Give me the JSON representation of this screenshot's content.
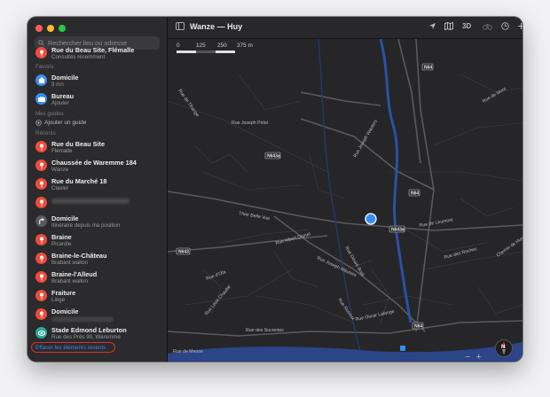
{
  "window": {
    "title": "Wanze — Huy"
  },
  "search": {
    "placeholder": "Rechercher lieu ou adresse"
  },
  "sidebar": {
    "partial_item": {
      "title": "Rue du Beau Site, Flémalle",
      "subtitle": "Consultés récemment"
    },
    "favorites_header": "Favoris",
    "favorites": [
      {
        "title": "Domicile",
        "subtitle": "9 mn",
        "icon": "home-icon",
        "color": "#3a8df5"
      },
      {
        "title": "Bureau",
        "subtitle": "Ajouter",
        "icon": "briefcase-icon",
        "color": "#3a8df5"
      }
    ],
    "guides_header": "Mes guides",
    "add_guide": "Ajouter un guide",
    "recents_header": "Récents",
    "recents": [
      {
        "title": "Rue du Beau Site",
        "subtitle": "Flémalle",
        "icon": "pin-icon",
        "color": "#ef4b3c"
      },
      {
        "title": "Chaussée de Waremme 184",
        "subtitle": "Wanze",
        "icon": "pin-icon",
        "color": "#ef4b3c"
      },
      {
        "title": "Rue du Marché 18",
        "subtitle": "Clavier",
        "icon": "pin-icon",
        "color": "#ef4b3c"
      },
      {
        "title": "",
        "subtitle": "",
        "icon": "pin-icon",
        "color": "#ef4b3c",
        "blurred": true
      },
      {
        "title": "Domicile",
        "subtitle": "Itinéraire depuis ma position",
        "icon": "directions-icon",
        "color": "#5a5a5e"
      },
      {
        "title": "Braine",
        "subtitle": "Picardie",
        "icon": "pin-icon",
        "color": "#ef4b3c"
      },
      {
        "title": "Braine-le-Château",
        "subtitle": "Brabant wallon",
        "icon": "pin-icon",
        "color": "#ef4b3c"
      },
      {
        "title": "Braine-l'Alleud",
        "subtitle": "Brabant wallon",
        "icon": "pin-icon",
        "color": "#ef4b3c"
      },
      {
        "title": "Fraiture",
        "subtitle": "Liège",
        "icon": "pin-icon",
        "color": "#ef4b3c"
      },
      {
        "title": "Domicile",
        "subtitle": "",
        "icon": "pin-icon",
        "color": "#ef4b3c",
        "blurred_subtitle": true
      },
      {
        "title": "Stade Edmond Leburton",
        "subtitle": "Rue des Prés 90, Waremme",
        "icon": "stadium-icon",
        "color": "#2fa79a"
      }
    ],
    "clear_recents": "Effacer les éléments récents"
  },
  "toolbar": {
    "mode_3d": "3D"
  },
  "map": {
    "scale": [
      "0",
      "125",
      "250",
      "375 m"
    ],
    "road_labels": [
      "Rue de Tihange",
      "Rue Joseph Pirlot",
      "Rue Joseph Wauters",
      "Thier Belle Vue",
      "Rue de Leumont",
      "Rue Albert Dignef",
      "Rue Désiré Boël",
      "Rue d'Ofa",
      "Rue Léon Chaufat",
      "Rue Joseph Wauters",
      "Rue Rosoux",
      "Rue Oscar Lalange",
      "Rue des Sucreries",
      "Rue de Meuse",
      "Rue des Roches",
      "Chemin de Huy",
      "Rue de Mont"
    ],
    "road_badges": [
      "N64",
      "N643a",
      "N64",
      "N643a",
      "N643",
      "N64"
    ],
    "zoom_minus": "−",
    "zoom_plus": "+",
    "compass_letter": "N"
  }
}
